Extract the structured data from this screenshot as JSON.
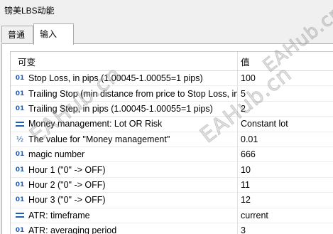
{
  "window": {
    "title": "镑美LBS动能"
  },
  "tabs": [
    {
      "label": "普通",
      "active": false
    },
    {
      "label": "输入",
      "active": true
    }
  ],
  "table": {
    "headers": {
      "variable": "可变",
      "value": "值"
    },
    "rows": [
      {
        "icon": "integer-icon",
        "icon_glyph": "01",
        "label": "Stop Loss, in pips (1.00045-1.00055=1 pips)",
        "value": "100"
      },
      {
        "icon": "integer-icon",
        "icon_glyph": "01",
        "label": "Trailing Stop (min distance from price to Stop Loss, in pips",
        "value": "5"
      },
      {
        "icon": "integer-icon",
        "icon_glyph": "01",
        "label": "Trailing Step, in pips (1.00045-1.00055=1 pips)",
        "value": "2"
      },
      {
        "icon": "enum-icon",
        "icon_glyph": "",
        "label": "Money management: Lot OR Risk",
        "value": "Constant lot"
      },
      {
        "icon": "fraction-icon",
        "icon_glyph": "½",
        "label": "The value for \"Money management\"",
        "value": "0.01"
      },
      {
        "icon": "integer-icon",
        "icon_glyph": "01",
        "label": "magic number",
        "value": "666"
      },
      {
        "icon": "integer-icon",
        "icon_glyph": "01",
        "label": "Hour 1 (\"0\" -> OFF)",
        "value": "10"
      },
      {
        "icon": "integer-icon",
        "icon_glyph": "01",
        "label": "Hour 2 (\"0\" -> OFF)",
        "value": "11"
      },
      {
        "icon": "integer-icon",
        "icon_glyph": "01",
        "label": "Hour 3 (\"0\" -> OFF)",
        "value": "12"
      },
      {
        "icon": "enum-icon",
        "icon_glyph": "",
        "label": "ATR: timeframe",
        "value": "current"
      },
      {
        "icon": "integer-icon",
        "icon_glyph": "01",
        "label": "ATR: averaging period",
        "value": "3"
      }
    ]
  },
  "watermark": {
    "text": "EAHub.cn"
  },
  "colors": {
    "icon_blue": "#1f5fb5",
    "background": "#f0f0f0",
    "grid_bg": "#ffffff"
  }
}
